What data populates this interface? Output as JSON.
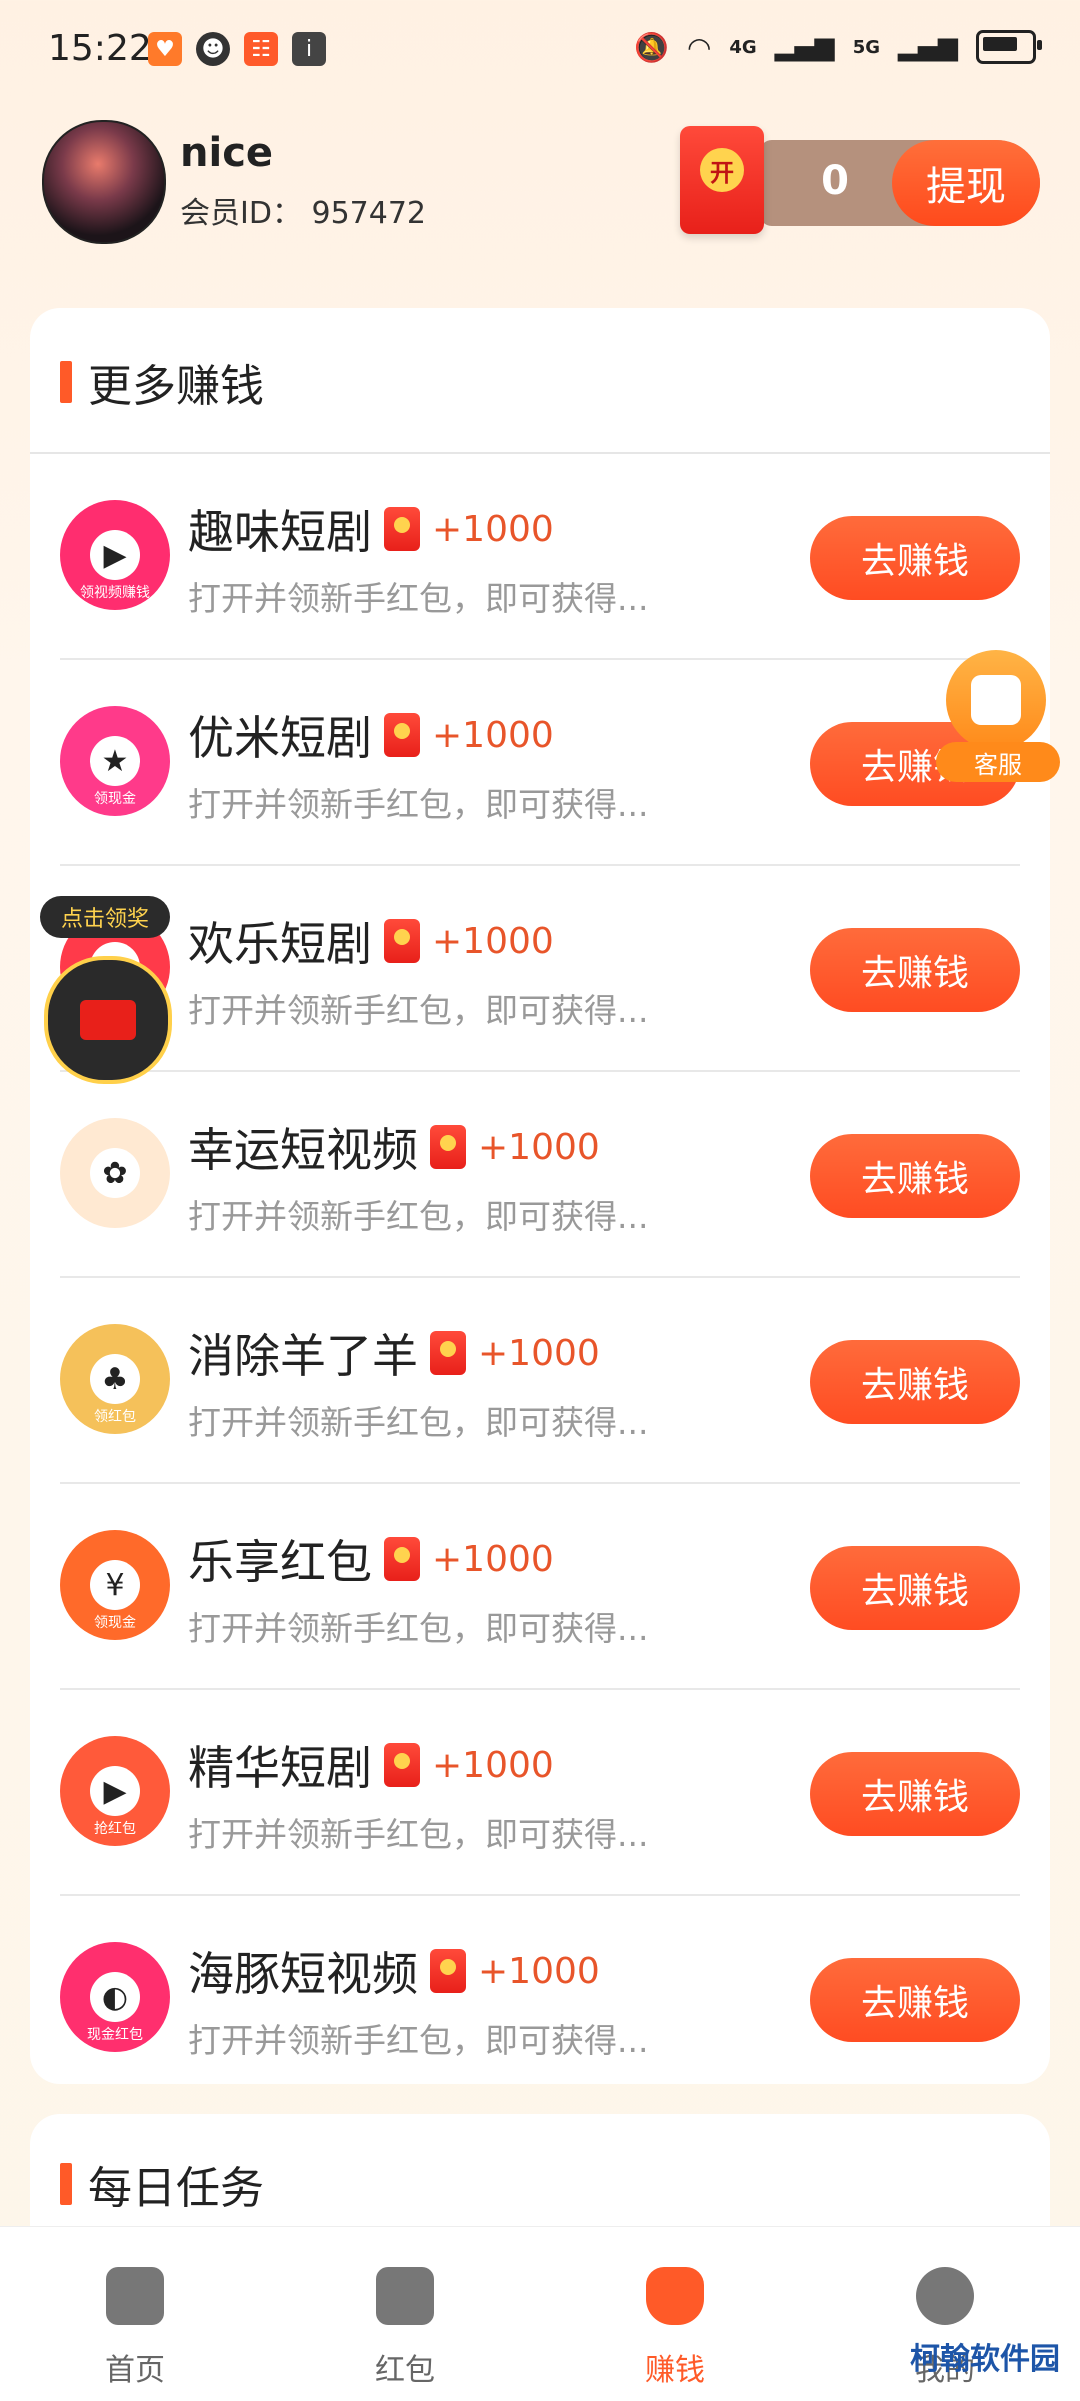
{
  "status_bar": {
    "time": "15:22",
    "network_left": "4G",
    "network_right": "5G"
  },
  "header": {
    "username": "nice",
    "member_id_label": "会员ID：",
    "member_id": "957472",
    "balance": "0",
    "withdraw_label": "提现",
    "redpacket_seal": "开"
  },
  "earn_section": {
    "title": "更多赚钱",
    "items": [
      {
        "name": "趣味短剧",
        "reward": "+1000",
        "desc": "打开并领新手红包，即可获得...",
        "button": "去赚钱",
        "icon_color": "#ff2d6f",
        "icon_glyph": "▶",
        "icon_ribbon": "领视频赚钱"
      },
      {
        "name": "优米短剧",
        "reward": "+1000",
        "desc": "打开并领新手红包，即可获得...",
        "button": "去赚钱",
        "icon_color": "#ff3a8a",
        "icon_glyph": "★",
        "icon_ribbon": "领现金"
      },
      {
        "name": "欢乐短剧",
        "reward": "+1000",
        "desc": "打开并领新手红包，即可获得...",
        "button": "去赚钱",
        "icon_color": "#ff3a4a",
        "icon_glyph": "▶",
        "icon_ribbon": ""
      },
      {
        "name": "幸运短视频",
        "reward": "+1000",
        "desc": "打开并领新手红包，即可获得...",
        "button": "去赚钱",
        "icon_color": "#ffe9d2",
        "icon_glyph": "✿",
        "icon_ribbon": ""
      },
      {
        "name": "消除羊了羊",
        "reward": "+1000",
        "desc": "打开并领新手红包，即可获得...",
        "button": "去赚钱",
        "icon_color": "#f5c15a",
        "icon_glyph": "♣",
        "icon_ribbon": "领红包"
      },
      {
        "name": "乐享红包",
        "reward": "+1000",
        "desc": "打开并领新手红包，即可获得...",
        "button": "去赚钱",
        "icon_color": "#ff6a2a",
        "icon_glyph": "¥",
        "icon_ribbon": "领现金"
      },
      {
        "name": "精华短剧",
        "reward": "+1000",
        "desc": "打开并领新手红包，即可获得...",
        "button": "去赚钱",
        "icon_color": "#ff5a3a",
        "icon_glyph": "▶",
        "icon_ribbon": "抢红包"
      },
      {
        "name": "海豚短视频",
        "reward": "+1000",
        "desc": "打开并领新手红包，即可获得...",
        "button": "去赚钱",
        "icon_color": "#ff2f6e",
        "icon_glyph": "◐",
        "icon_ribbon": "现金红包"
      }
    ]
  },
  "daily_section": {
    "title": "每日任务"
  },
  "floating": {
    "claim_label": "点击领奖",
    "service_label": "客服"
  },
  "tabbar": {
    "items": [
      {
        "label": "首页",
        "active": false
      },
      {
        "label": "红包",
        "active": false
      },
      {
        "label": "赚钱",
        "active": true
      },
      {
        "label": "我的",
        "active": false
      }
    ]
  },
  "watermark": "柯翰软件园"
}
